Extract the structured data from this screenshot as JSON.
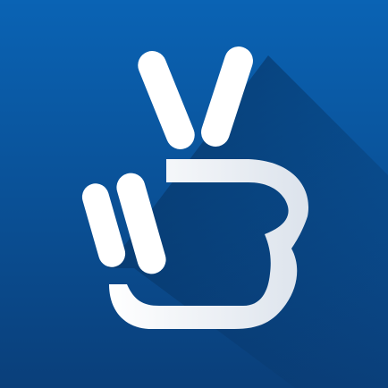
{
  "icon": {
    "name": "peace-hand-icon",
    "colors": {
      "background_top": "#0a63b4",
      "background_bottom": "#0a3f7a",
      "shadow": "#062f5c",
      "glyph": "#ffffff",
      "glyph_shade": "#dce3ec"
    }
  }
}
